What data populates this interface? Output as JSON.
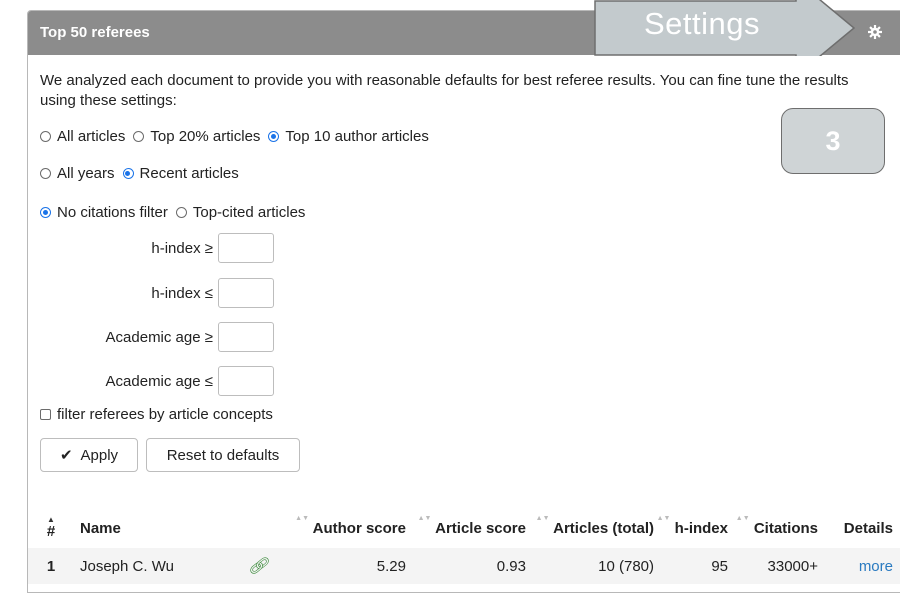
{
  "panel": {
    "title": "Top 50 referees",
    "intro": "We analyzed each document to provide you with reasonable defaults for best referee results. You can fine tune the results using these settings:"
  },
  "options": {
    "scope": [
      {
        "label": "All articles",
        "selected": false
      },
      {
        "label": "Top 20% articles",
        "selected": false
      },
      {
        "label": "Top 10 author articles",
        "selected": true
      }
    ],
    "years": [
      {
        "label": "All years",
        "selected": false
      },
      {
        "label": "Recent articles",
        "selected": true
      }
    ],
    "citations": [
      {
        "label": "No citations filter",
        "selected": true
      },
      {
        "label": "Top-cited articles",
        "selected": false
      }
    ]
  },
  "filters": {
    "hindex_min_label": "h-index ≥",
    "hindex_max_label": "h-index ≤",
    "age_min_label": "Academic age ≥",
    "age_max_label": "Academic age ≤",
    "concepts_label": "filter referees by article concepts"
  },
  "buttons": {
    "apply": "Apply",
    "reset": "Reset to defaults"
  },
  "table": {
    "headers": [
      "#",
      "Name",
      "Author score",
      "Article score",
      "Articles (total)",
      "h-index",
      "Citations",
      "Details"
    ],
    "rows": [
      {
        "rank": "1",
        "name": "Joseph C. Wu",
        "author_score": "5.29",
        "article_score": "0.93",
        "articles": "10 (780)",
        "hindex": "95",
        "citations": "33000+",
        "details": "more"
      }
    ]
  },
  "annotations": {
    "callout": "Settings",
    "badge": "3"
  },
  "colors": {
    "header_bg": "#8c8c8c",
    "radio_selected": "#1a73e8",
    "link": "#2a7ac0",
    "callout_fill": "#c3cacd"
  }
}
